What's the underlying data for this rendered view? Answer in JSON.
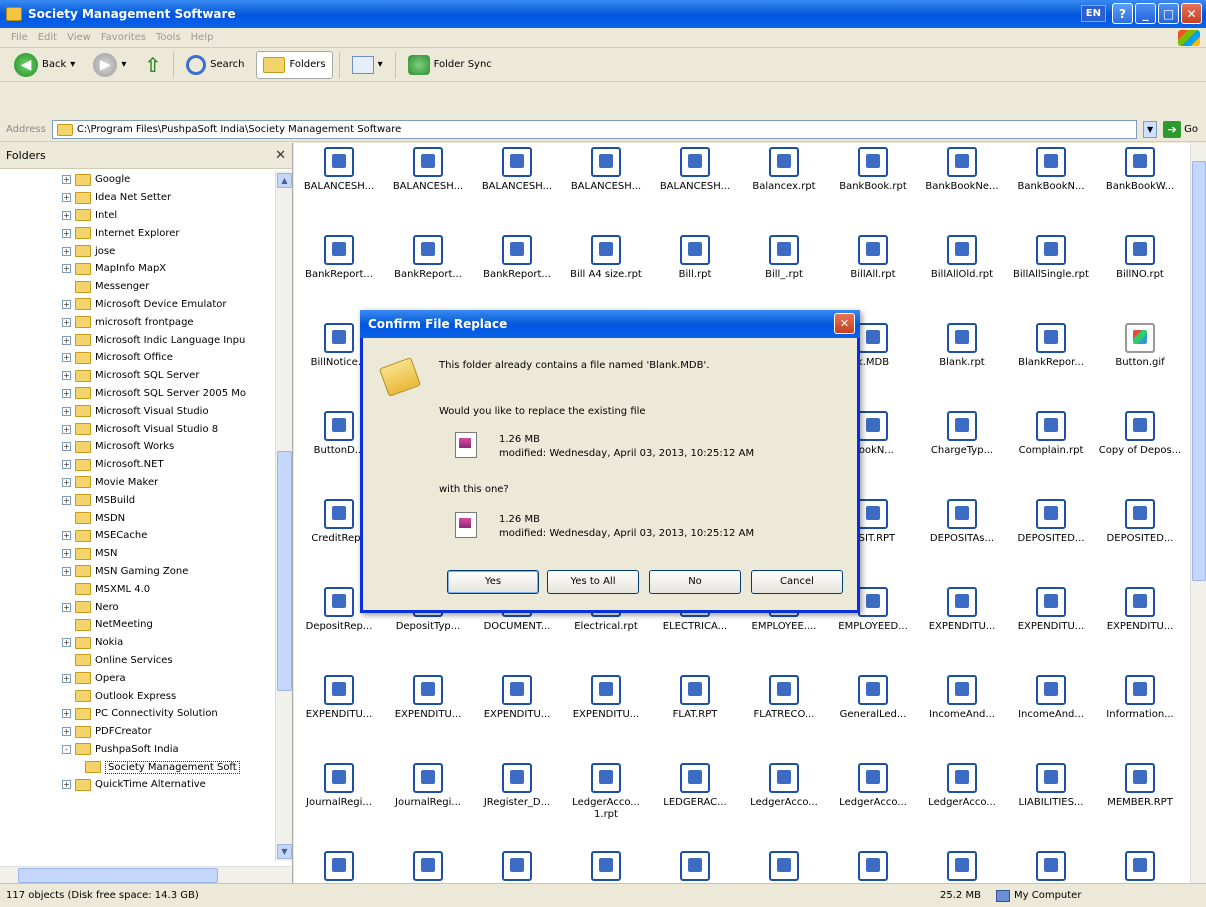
{
  "window": {
    "title": "Society Management Software",
    "lang": "EN"
  },
  "menu": [
    "File",
    "Edit",
    "View",
    "Favorites",
    "Tools",
    "Help"
  ],
  "toolbar": {
    "back": "Back",
    "search": "Search",
    "folders": "Folders",
    "folder_sync": "Folder Sync"
  },
  "address": {
    "label": "Address",
    "value": "C:\\Program Files\\PushpaSoft India\\Society Management Software",
    "go": "Go"
  },
  "folders_pane": {
    "title": "Folders",
    "items": [
      {
        "label": "Google",
        "exp": "+"
      },
      {
        "label": "Idea Net Setter",
        "exp": "+"
      },
      {
        "label": "Intel",
        "exp": "+"
      },
      {
        "label": "Internet Explorer",
        "exp": "+"
      },
      {
        "label": "jose",
        "exp": "+"
      },
      {
        "label": "MapInfo MapX",
        "exp": "+"
      },
      {
        "label": "Messenger",
        "exp": ""
      },
      {
        "label": "Microsoft Device Emulator",
        "exp": "+"
      },
      {
        "label": "microsoft frontpage",
        "exp": "+"
      },
      {
        "label": "Microsoft Indic Language Inpu",
        "exp": "+"
      },
      {
        "label": "Microsoft Office",
        "exp": "+"
      },
      {
        "label": "Microsoft SQL Server",
        "exp": "+"
      },
      {
        "label": "Microsoft SQL Server 2005 Mo",
        "exp": "+"
      },
      {
        "label": "Microsoft Visual Studio",
        "exp": "+"
      },
      {
        "label": "Microsoft Visual Studio 8",
        "exp": "+"
      },
      {
        "label": "Microsoft Works",
        "exp": "+"
      },
      {
        "label": "Microsoft.NET",
        "exp": "+"
      },
      {
        "label": "Movie Maker",
        "exp": "+"
      },
      {
        "label": "MSBuild",
        "exp": "+"
      },
      {
        "label": "MSDN",
        "exp": ""
      },
      {
        "label": "MSECache",
        "exp": "+"
      },
      {
        "label": "MSN",
        "exp": "+"
      },
      {
        "label": "MSN Gaming Zone",
        "exp": "+"
      },
      {
        "label": "MSXML 4.0",
        "exp": ""
      },
      {
        "label": "Nero",
        "exp": "+"
      },
      {
        "label": "NetMeeting",
        "exp": ""
      },
      {
        "label": "Nokia",
        "exp": "+"
      },
      {
        "label": "Online Services",
        "exp": ""
      },
      {
        "label": "Opera",
        "exp": "+"
      },
      {
        "label": "Outlook Express",
        "exp": ""
      },
      {
        "label": "PC Connectivity Solution",
        "exp": "+"
      },
      {
        "label": "PDFCreator",
        "exp": "+"
      },
      {
        "label": "PushpaSoft India",
        "exp": "-"
      },
      {
        "label": "Society Management Soft",
        "exp": "",
        "sub": true,
        "selected": true
      },
      {
        "label": "QuickTime Alternative",
        "exp": "+"
      }
    ]
  },
  "files": [
    "BALANCESH...",
    "BALANCESH...",
    "BALANCESH...",
    "BALANCESH...",
    "BALANCESH...",
    "Balancex.rpt",
    "BankBook.rpt",
    "BankBookNe...",
    "BankBookN...",
    "BankBookW...",
    "BankReport...",
    "BankReport...",
    "BankReport...",
    "Bill A4 size.rpt",
    "Bill.rpt",
    "Bill_.rpt",
    "BillAll.rpt",
    "BillAllOld.rpt",
    "BillAllSingle.rpt",
    "BillNO.rpt",
    "BillNotice...",
    "",
    "",
    "",
    "",
    "",
    "k.MDB",
    "Blank.rpt",
    "BlankRepor...",
    "Button.gif",
    "ButtonD...",
    "",
    "",
    "",
    "",
    "",
    "BookN...",
    "ChargeTyp...",
    "Complain.rpt",
    "Copy of Depos...",
    "CreditRepo",
    "",
    "",
    "",
    "",
    "",
    "OSIT.RPT",
    "DEPOSITAs...",
    "DEPOSITED...",
    "DEPOSITED...",
    "DepositRep...",
    "DepositTyp...",
    "DOCUMENT...",
    "Electrical.rpt",
    "ELECTRICA...",
    "EMPLOYEE....",
    "EMPLOYEED...",
    "EXPENDITU...",
    "EXPENDITU...",
    "EXPENDITU...",
    "EXPENDITU...",
    "EXPENDITU...",
    "EXPENDITU...",
    "EXPENDITU...",
    "FLAT.RPT",
    "FLATRECO...",
    "GeneralLed...",
    "IncomeAnd...",
    "IncomeAnd...",
    "Information...",
    "JournalRegi...",
    "JournalRegi...",
    "JRegister_D...",
    "LedgerAcco... 1.rpt",
    "LEDGERAC...",
    "LedgerAcco...",
    "LedgerAcco...",
    "LedgerAcco...",
    "LIABILITIES...",
    "MEMBER.RPT",
    "",
    "",
    "",
    "",
    "",
    "",
    "",
    "",
    "",
    ""
  ],
  "status": {
    "objects": "117 objects (Disk free space: 14.3 GB)",
    "size": "25.2 MB",
    "location": "My Computer"
  },
  "dialog": {
    "title": "Confirm File Replace",
    "message": "This folder already contains a file named 'Blank.MDB'.",
    "question": "Would you like to replace the existing file",
    "existing_size": "1.26 MB",
    "existing_modified": "modified: Wednesday, April 03, 2013, 10:25:12 AM",
    "with_this": "with this one?",
    "new_size": "1.26 MB",
    "new_modified": "modified: Wednesday, April 03, 2013, 10:25:12 AM",
    "buttons": {
      "yes": "Yes",
      "yes_all": "Yes to All",
      "no": "No",
      "cancel": "Cancel"
    }
  }
}
